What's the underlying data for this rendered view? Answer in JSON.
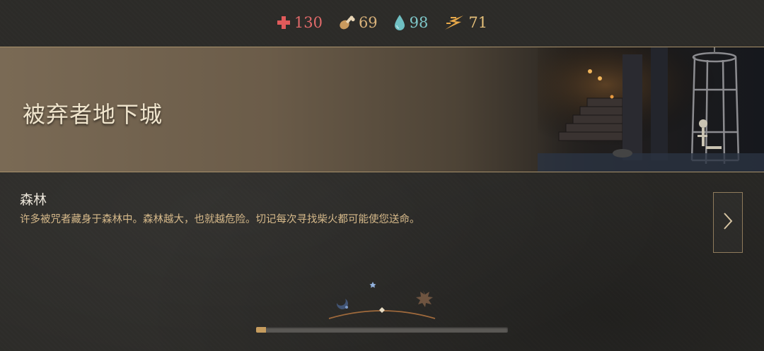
{
  "stats": {
    "health": {
      "icon": "health-cross-icon",
      "value": "130",
      "color": "#e06a6a"
    },
    "food": {
      "icon": "meat-drumstick-icon",
      "value": "69",
      "color": "#d9b27a"
    },
    "water": {
      "icon": "water-drop-icon",
      "value": "98",
      "color": "#7fc7c9"
    },
    "energy": {
      "icon": "lightning-bolt-icon",
      "value": "71",
      "color": "#e6c07a"
    }
  },
  "banner": {
    "title": "被弃者地下城",
    "art": "dungeon-cage-skeleton-illustration"
  },
  "area": {
    "name": "森林",
    "description": "许多被咒者藏身于森林中。森林越大，也就越危险。切记每次寻找柴火都可能使您送命。"
  },
  "next_button": {
    "icon": "chevron-right-icon"
  },
  "time_indicator": {
    "icons": [
      "moon-icon",
      "star-icon",
      "sun-icon"
    ]
  },
  "progress": {
    "fraction": 0.04,
    "fill_color": "#c69c5e"
  }
}
